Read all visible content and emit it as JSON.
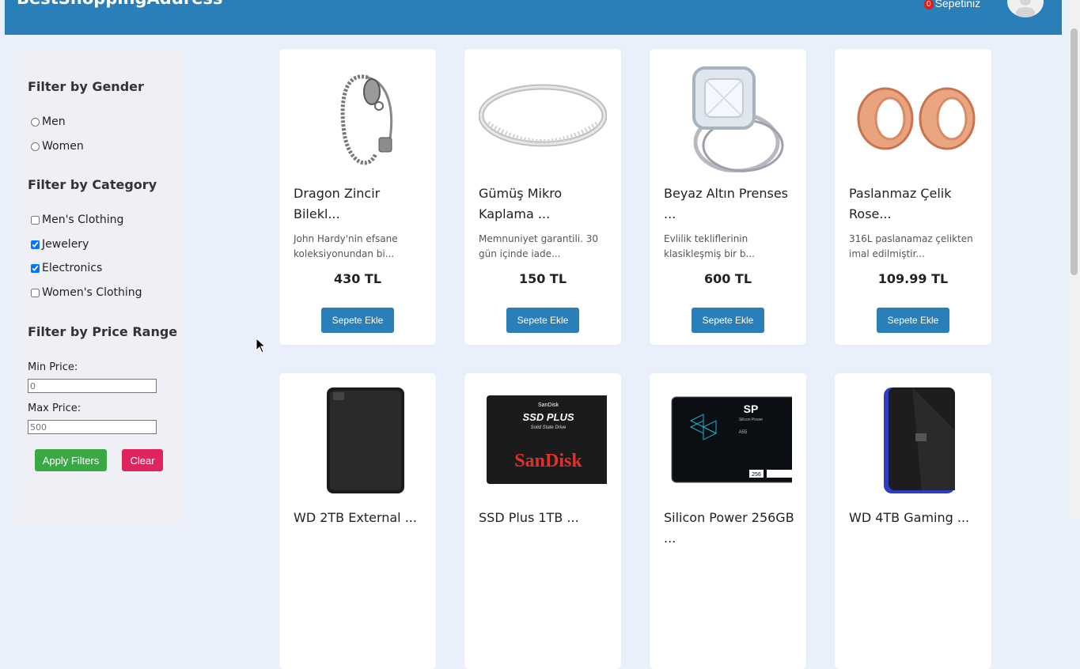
{
  "header": {
    "brand": "BestShoppingAddress",
    "cart_count": "0",
    "cart_label": "Sepetiniz"
  },
  "sidebar": {
    "gender_title": "Filter by Gender",
    "gender_options": [
      {
        "label": "Men",
        "checked": false
      },
      {
        "label": "Women",
        "checked": false
      }
    ],
    "category_title": "Filter by Category",
    "category_options": [
      {
        "label": "Men's Clothing",
        "checked": false
      },
      {
        "label": "Jewelery",
        "checked": true
      },
      {
        "label": "Electronics",
        "checked": true
      },
      {
        "label": "Women's Clothing",
        "checked": false
      }
    ],
    "price_title": "Filter by Price Range",
    "min_label": "Min Price:",
    "min_placeholder": "0",
    "max_label": "Max Price:",
    "max_placeholder": "500",
    "apply_label": "Apply Filters",
    "clear_label": "Clear"
  },
  "products": [
    {
      "title": "Dragon Zincir Bilekl...",
      "desc": "John Hardy'nin efsane koleksiyonundan bi...",
      "price": "430 TL",
      "button": "Sepete Ekle",
      "icon": "bracelet-icon"
    },
    {
      "title": "Gümüş Mikro Kaplama ...",
      "desc": "Memnuniyet garantili. 30 gün içinde iade...",
      "price": "150 TL",
      "button": "Sepete Ekle",
      "icon": "ring-icon"
    },
    {
      "title": "Beyaz Altın Prenses ...",
      "desc": "Evlilik tekliflerinin klasikleşmiş bir b...",
      "price": "600 TL",
      "button": "Sepete Ekle",
      "icon": "diamond-ring-icon"
    },
    {
      "title": "Paslanmaz Çelik Rose...",
      "desc": "316L paslanamaz çelikten imal edilmiştir...",
      "price": "109.99 TL",
      "button": "Sepete Ekle",
      "icon": "ear-tunnel-icon"
    },
    {
      "title": "WD 2TB External ...",
      "icon": "hard-drive-icon"
    },
    {
      "title": "SSD Plus 1TB ...",
      "icon": "ssd-icon",
      "img_text": [
        "SanDisk",
        "SSD PLUS",
        "Solid State Drive",
        "SanDisk"
      ]
    },
    {
      "title": "Silicon Power 256GB ...",
      "icon": "ssd-icon",
      "img_text": [
        "SP",
        "Silicon Power",
        "A55",
        "256"
      ]
    },
    {
      "title": "WD 4TB Gaming ...",
      "icon": "gaming-drive-icon"
    }
  ],
  "colors": {
    "header": "#2a7fb8",
    "apply": "#3aa844",
    "clear": "#e0245e",
    "badge": "#e01b1b"
  }
}
